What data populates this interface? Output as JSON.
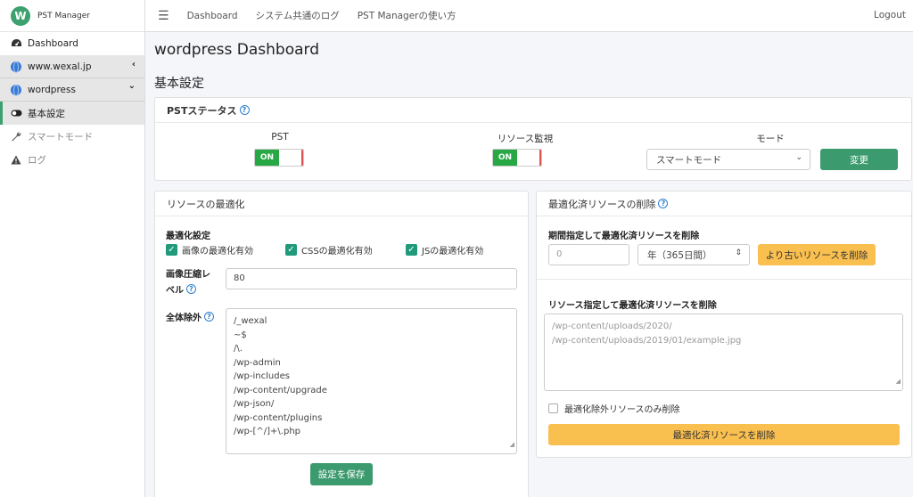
{
  "brand": {
    "logo_letter": "W",
    "name": "PST Manager"
  },
  "sidebar": {
    "items": [
      {
        "label": "Dashboard",
        "icon": "dashboard-icon"
      },
      {
        "label": "www.wexal.jp",
        "icon": "globe-icon",
        "chevron": "‹"
      },
      {
        "label": "wordpress",
        "icon": "globe-icon",
        "chevron": "⌄"
      },
      {
        "label": "基本設定",
        "icon": "toggle-icon"
      },
      {
        "label": "スマートモード",
        "icon": "wrench-icon"
      },
      {
        "label": "ログ",
        "icon": "warning-icon"
      }
    ]
  },
  "topnav": {
    "links": [
      "Dashboard",
      "システム共通のログ",
      "PST Managerの使い方"
    ],
    "logout": "Logout"
  },
  "page": {
    "title": "wordpress Dashboard",
    "section": "基本設定"
  },
  "status": {
    "header": "PSTステータス",
    "pst_label": "PST",
    "pst_state": "ON",
    "monitor_label": "リソース監視",
    "monitor_state": "ON",
    "mode_label": "モード",
    "mode_value": "スマートモード",
    "change_button": "変更"
  },
  "optimize": {
    "header": "リソースの最適化",
    "settings_label": "最適化設定",
    "checks": [
      "画像の最適化有効",
      "CSSの最適化有効",
      "JSの最適化有効"
    ],
    "compress_label_1": "画像圧縮レ",
    "compress_label_2": "ベル",
    "compress_value": "80",
    "exclude_label": "全体除外",
    "exclude_lines": [
      "/_wexal",
      "~$",
      "/\\.",
      "/wp-admin",
      "/wp-includes",
      "/wp-content/upgrade",
      "/wp-json/",
      "/wp-content/plugins",
      "/wp-[^/]+\\.php"
    ],
    "save_button": "設定を保存"
  },
  "delete": {
    "header": "最適化済リソースの削除",
    "period_label": "期間指定して最適化済リソースを削除",
    "period_input_placeholder": "0",
    "period_select": "年（365日間）",
    "delete_old_button": "より古いリソースを削除",
    "resource_label": "リソース指定して最適化済リソースを削除",
    "resource_placeholder_1": "/wp-content/uploads/2020/",
    "resource_placeholder_2": "/wp-content/uploads/2019/01/example.jpg",
    "only_excluded_label": "最適化除外リソースのみ削除",
    "delete_button": "最適化済リソースを削除"
  },
  "colors": {
    "accent": "#3ca06f",
    "on_green": "#28a745",
    "warning": "#f9bf4f",
    "link": "#2f7fd0"
  }
}
